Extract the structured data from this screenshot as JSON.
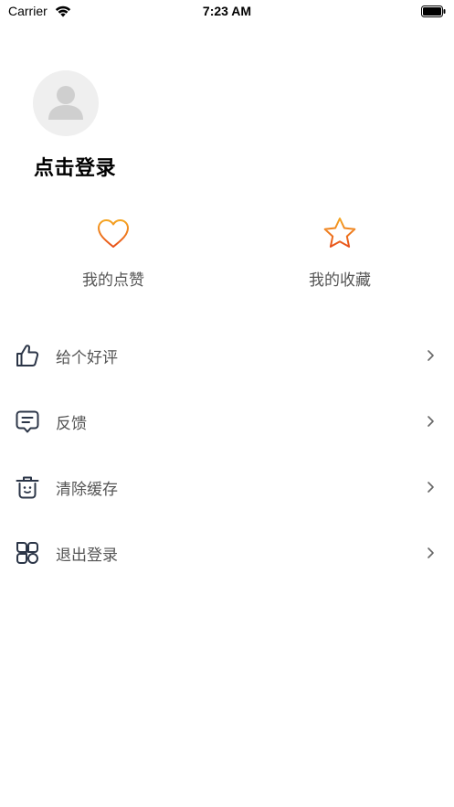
{
  "status_bar": {
    "carrier": "Carrier",
    "time": "7:23 AM"
  },
  "profile": {
    "login_title": "点击登录"
  },
  "quick_actions": [
    {
      "label": "我的点赞",
      "icon": "heart-icon"
    },
    {
      "label": "我的收藏",
      "icon": "star-icon"
    }
  ],
  "menu": [
    {
      "label": "给个好评",
      "icon": "thumbs-up-icon"
    },
    {
      "label": "反馈",
      "icon": "feedback-chat-icon"
    },
    {
      "label": "清除缓存",
      "icon": "trash-icon"
    },
    {
      "label": "退出登录",
      "icon": "apps-grid-icon"
    }
  ],
  "colors": {
    "accent_gradient_start": "#f5a623",
    "accent_gradient_end": "#e8501a",
    "menu_icon": "#2b3547",
    "label_gray": "#555555",
    "avatar_bg": "#efefef"
  }
}
